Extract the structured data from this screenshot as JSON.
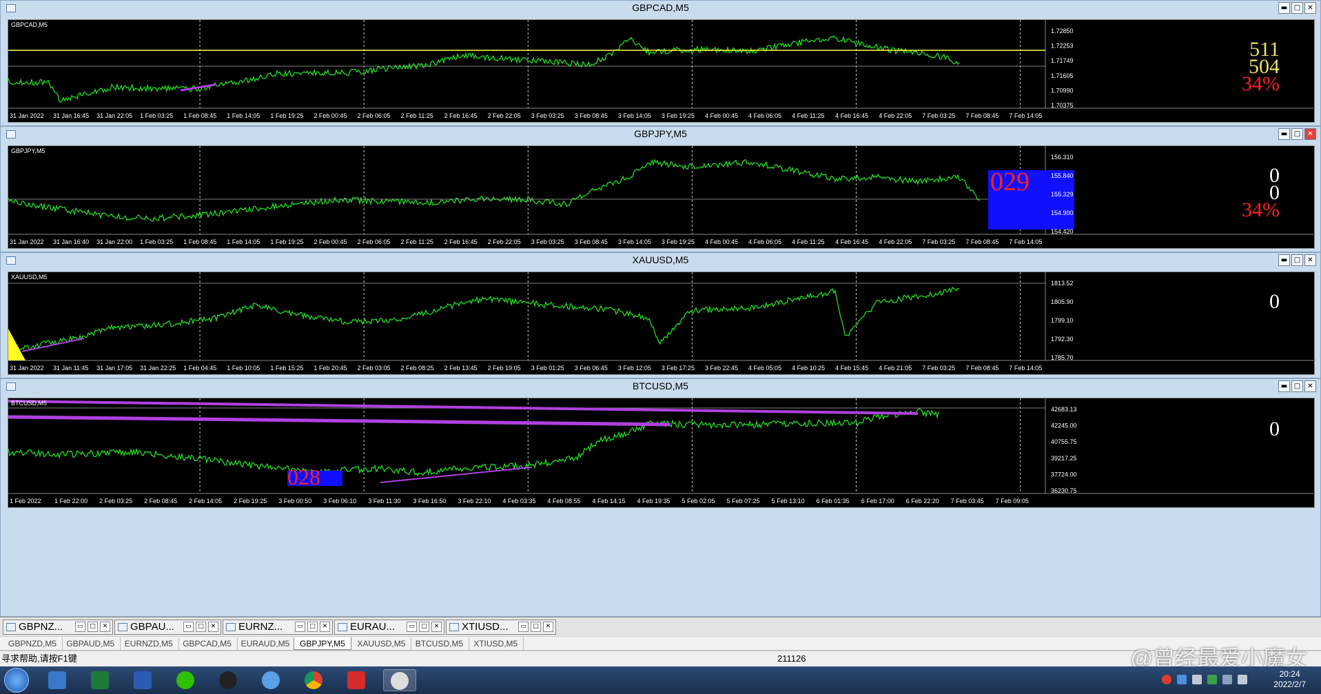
{
  "windows": [
    {
      "title": "GBPCAD,M5",
      "label": "GBPCAD,M5",
      "prices": [
        "1.72850",
        "1.72253",
        "1.71749",
        "1.71605",
        "1.70990",
        "1.70375"
      ],
      "times": [
        "31 Jan 2022",
        "31 Jan 16:45",
        "31 Jan 22:05",
        "1 Feb 03:25",
        "1 Feb 08:45",
        "1 Feb 14:05",
        "1 Feb 19:25",
        "2 Feb 00:45",
        "2 Feb 06:05",
        "2 Feb 11:25",
        "2 Feb 16:45",
        "2 Feb 22:05",
        "3 Feb 03:25",
        "3 Feb 08:45",
        "3 Feb 14:05",
        "3 Feb 19:25",
        "4 Feb 00:45",
        "4 Feb 06:05",
        "4 Feb 11:25",
        "4 Feb 16:45",
        "4 Feb 22:05",
        "7 Feb 03:25",
        "7 Feb 08:45",
        "7 Feb 14:05"
      ],
      "big": [
        "511",
        "504",
        "34%"
      ],
      "bigColors": [
        "#f0e060",
        "#f0e060",
        "#ff2020"
      ]
    },
    {
      "title": "GBPJPY,M5",
      "label": "GBPJPY,M5",
      "prices": [
        "156.310",
        "155.840",
        "155.329",
        "154.900",
        "154.420"
      ],
      "times": [
        "31 Jan 2022",
        "31 Jan 16:40",
        "31 Jan 22:00",
        "1 Feb 03:25",
        "1 Feb 08:45",
        "1 Feb 14:05",
        "1 Feb 19:25",
        "2 Feb 00:45",
        "2 Feb 06:05",
        "2 Feb 11:25",
        "2 Feb 16:45",
        "2 Feb 22:05",
        "3 Feb 03:25",
        "3 Feb 08:45",
        "3 Feb 14:05",
        "3 Feb 19:25",
        "4 Feb 00:45",
        "4 Feb 06:05",
        "4 Feb 11:25",
        "4 Feb 16:45",
        "4 Feb 22:05",
        "7 Feb 03:25",
        "7 Feb 08:45",
        "7 Feb 14:05"
      ],
      "big": [
        "0",
        "0",
        "34%"
      ],
      "bigColors": [
        "#ffffff",
        "#ffffff",
        "#ff2020"
      ],
      "box": "029"
    },
    {
      "title": "XAUUSD,M5",
      "label": "XAUUSD,M5",
      "prices": [
        "1813.52",
        "1805.90",
        "1799.10",
        "1792.30",
        "1785.70"
      ],
      "times": [
        "31 Jan 2022",
        "31 Jan 11:45",
        "31 Jan 17:05",
        "31 Jan 22:25",
        "1 Feb 04:45",
        "1 Feb 10:05",
        "1 Feb 15:25",
        "1 Feb 20:45",
        "2 Feb 03:05",
        "2 Feb 08:25",
        "2 Feb 13:45",
        "2 Feb 19:05",
        "3 Feb 01:25",
        "3 Feb 06:45",
        "3 Feb 12:05",
        "3 Feb 17:25",
        "3 Feb 22:45",
        "4 Feb 05:05",
        "4 Feb 10:25",
        "4 Feb 15:45",
        "4 Feb 21:05",
        "7 Feb 03:25",
        "7 Feb 08:45",
        "7 Feb 14:05"
      ],
      "big": [
        "0"
      ],
      "bigColors": [
        "#ffffff"
      ]
    },
    {
      "title": "BTCUSD,M5",
      "label": "BTCUSD,M5",
      "prices": [
        "42683.13",
        "42245.00",
        "40755.75",
        "39217.25",
        "37724.00",
        "36230.75"
      ],
      "times": [
        "1 Feb 2022",
        "1 Feb 22:00",
        "2 Feb 03:25",
        "2 Feb 08:45",
        "2 Feb 14:05",
        "2 Feb 19:25",
        "3 Feb 00:50",
        "3 Feb 06:10",
        "3 Feb 11:30",
        "3 Feb 16:50",
        "3 Feb 22:10",
        "4 Feb 03:35",
        "4 Feb 08:55",
        "4 Feb 14:15",
        "4 Feb 19:35",
        "5 Feb 02:05",
        "5 Feb 07:25",
        "5 Feb 13:10",
        "6 Feb 01:35",
        "6 Feb 17:00",
        "6 Feb 22:20",
        "7 Feb 03:45",
        "7 Feb 09:05"
      ],
      "big": [
        "0"
      ],
      "bigColors": [
        "#ffffff"
      ],
      "box": "028"
    }
  ],
  "mdiTabs": [
    "GBPNZ...",
    "GBPAU...",
    "EURNZ...",
    "EURAU...",
    "XTIUSD..."
  ],
  "sheetTabs": [
    "GBPNZD,M5",
    "GBPAUD,M5",
    "EURNZD,M5",
    "GBPCAD,M5",
    "EURAUD,M5",
    "GBPJPY,M5",
    "XAUUSD,M5",
    "BTCUSD,M5",
    "XTIUSD,M5"
  ],
  "activeSheet": "GBPJPY,M5",
  "status": {
    "help": "寻求帮助,请按F1键",
    "bars": "211126"
  },
  "clock": {
    "time": "20:24",
    "date": "2022/2/7"
  },
  "watermark": "@曾经最爱小魔女",
  "colors": {
    "line": "#22dd22",
    "grid": "#cfcfcf",
    "hline": "#ffff44",
    "purple": "#b040e0",
    "box": "#1010ff",
    "boxText": "#ff2020"
  }
}
